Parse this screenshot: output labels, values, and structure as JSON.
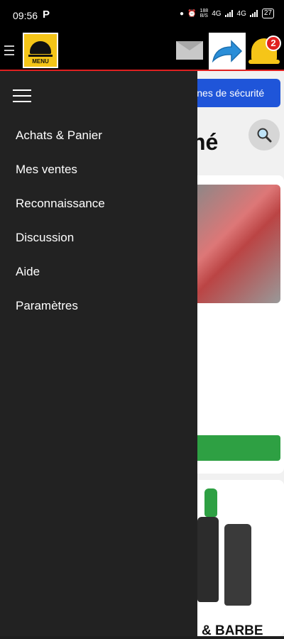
{
  "status_bar": {
    "time": "09:56",
    "app_letter": "P",
    "data_rate": "188",
    "data_rate_unit": "B/S",
    "network1": "4G",
    "network2": "4G",
    "battery": "27"
  },
  "header": {
    "menu_logo_text": "MENU",
    "notification_count": "2"
  },
  "safety_button": "Lire les consignes de sécurité",
  "page_title_partial": "né",
  "card2_title_partial": "& BARBE",
  "drawer": {
    "items": [
      "Achats & Panier",
      "Mes ventes",
      "Reconnaissance",
      "Discussion",
      "Aide",
      "Paramètres"
    ]
  },
  "colors": {
    "accent": "#1f55d9",
    "bell": "#f5c518",
    "badge": "#e02020",
    "action": "#2ea043"
  },
  "icons": [
    "hamburger-icon",
    "menu-cloche-icon",
    "envelope-icon",
    "share-arrow-icon",
    "bell-icon",
    "search-icon"
  ]
}
